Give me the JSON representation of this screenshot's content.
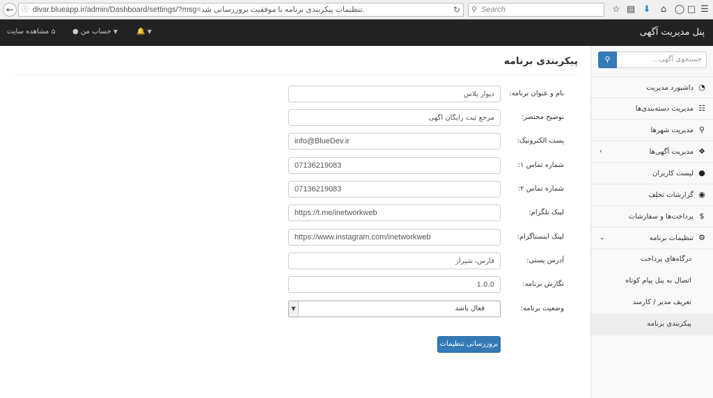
{
  "browser": {
    "url": "divar.blueapp.ir/admin/Dashboard/settings/?msg=تنظیمات پیکربندی برنامه با موفقیت بروزرسانی شد.",
    "search_placeholder": "Search"
  },
  "topnav": {
    "brand": "پنل مدیریت آگهی",
    "view_site": "مشاهده سایت",
    "my_account": "حساب من"
  },
  "sidebar": {
    "search_placeholder": "جستجوی آگهی...",
    "items": [
      {
        "label": "داشبورد مدیریت",
        "icon": "dashboard-icon"
      },
      {
        "label": "مدیریت دسته‌بندی‌ها",
        "icon": "sitemap-icon"
      },
      {
        "label": "مدیریت شهرها",
        "icon": "map-marker-icon"
      },
      {
        "label": "مدیریت آگهی‌ها",
        "icon": "cubes-icon"
      },
      {
        "label": "لیست کاربران",
        "icon": "user-icon"
      },
      {
        "label": "گزارشات تخلف",
        "icon": "comment-icon"
      },
      {
        "label": "پرداخت‌ها و سفارشات",
        "icon": "dollar-icon"
      },
      {
        "label": "تنظیمات برنامه",
        "icon": "gear-icon"
      }
    ],
    "sub_items": [
      {
        "label": "درگاه‌های پرداخت"
      },
      {
        "label": "اتصال به پنل پیام کوتاه"
      },
      {
        "label": "تعریف مدیر / کارمند"
      },
      {
        "label": "پیکربندی برنامه"
      }
    ]
  },
  "main": {
    "title": "پیکربندی برنامه",
    "fields": [
      {
        "label": "نام و عنوان برنامه:",
        "value": "دیوار پلاس"
      },
      {
        "label": "توضیح مختصر:",
        "value": "مرجع ثبت رایگان آگهی"
      },
      {
        "label": "پست الکترونیک:",
        "value": "info@BlueDev.ir"
      },
      {
        "label": "شماره تماس ۱:",
        "value": "07136219083"
      },
      {
        "label": "شماره تماس ۲:",
        "value": "07136219083"
      },
      {
        "label": "لینک تلگرام:",
        "value": "https://t.me/inetworkweb"
      },
      {
        "label": "لینک اینستاگرام:",
        "value": "https://www.instagram.com/inetworkweb"
      },
      {
        "label": "آدرس پستی:",
        "value": "فارس، شیراز"
      },
      {
        "label": "نگارش برنامه:",
        "value": "1.0.0"
      }
    ],
    "status": {
      "label": "وضعیت برنامه:",
      "value": "فعال باشد"
    },
    "submit_label": "بروزرسانی تنظیمات"
  },
  "colors": {
    "navbar_bg": "#222222",
    "primary": "#337ab7",
    "sidebar_bg": "#f8f8f8"
  }
}
